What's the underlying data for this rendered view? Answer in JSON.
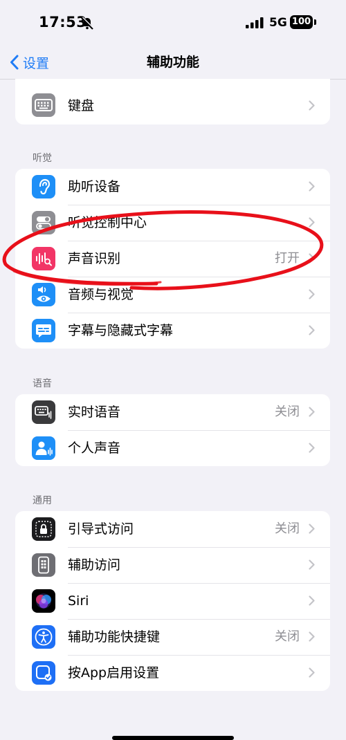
{
  "status": {
    "time": "17:53",
    "network": "5G",
    "battery": "100"
  },
  "nav": {
    "back_label": "设置",
    "title": "辅助功能"
  },
  "keyboard_row": {
    "label": "键盘"
  },
  "hearing": {
    "header": "听觉",
    "items": [
      {
        "label": "助听设备",
        "value": ""
      },
      {
        "label": "听觉控制中心",
        "value": ""
      },
      {
        "label": "声音识别",
        "value": "打开"
      },
      {
        "label": "音频与视觉",
        "value": ""
      },
      {
        "label": "字幕与隐藏式字幕",
        "value": ""
      }
    ]
  },
  "speech": {
    "header": "语音",
    "items": [
      {
        "label": "实时语音",
        "value": "关闭"
      },
      {
        "label": "个人声音",
        "value": ""
      }
    ]
  },
  "general": {
    "header": "通用",
    "items": [
      {
        "label": "引导式访问",
        "value": "关闭"
      },
      {
        "label": "辅助访问",
        "value": ""
      },
      {
        "label": "Siri",
        "value": ""
      },
      {
        "label": "辅助功能快捷键",
        "value": "关闭"
      },
      {
        "label": "按App启用设置",
        "value": ""
      }
    ]
  },
  "icons": {
    "hearing": [
      "ear-icon",
      "toggle-switches-icon",
      "sound-recognition-icon",
      "audio-visual-icon",
      "captions-icon"
    ],
    "speech": [
      "keyboard-waveform-icon",
      "personal-voice-icon"
    ],
    "general": [
      "lock-icon",
      "assistive-access-icon",
      "siri-icon",
      "accessibility-icon",
      "app-settings-icon"
    ]
  },
  "colors": {
    "accent": "#1f7cf6",
    "annotation": "#e8101a",
    "sound_recognition": "#f23566"
  }
}
